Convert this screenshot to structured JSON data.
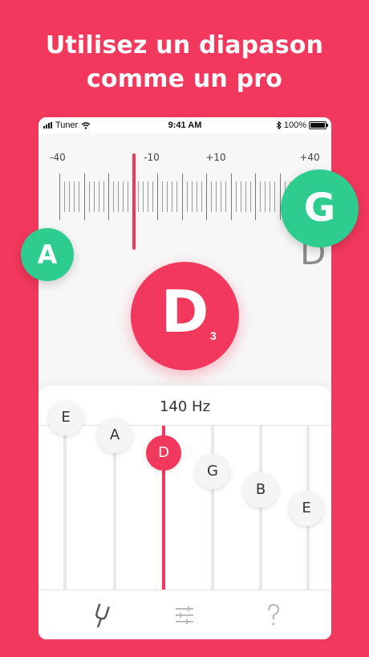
{
  "headline": {
    "line1": "Utilisez un diapason",
    "line2": "comme un pro"
  },
  "status_bar": {
    "carrier": "Tuner",
    "time": "9:41 AM",
    "battery": "100%"
  },
  "tuner": {
    "scale_labels": [
      "-40",
      "-10",
      "+10",
      "+40"
    ],
    "ghost_note": "D",
    "note": "D",
    "octave": "3",
    "frequency": "140 Hz",
    "strings": [
      "E",
      "A",
      "D",
      "G",
      "B",
      "E"
    ],
    "active_string_index": 2
  },
  "bubbles": {
    "left": "A",
    "right": "G"
  },
  "tabs": [
    {
      "name": "tuner-tab",
      "icon": "tuning-fork-icon"
    },
    {
      "name": "settings-tab",
      "icon": "sliders-icon"
    },
    {
      "name": "help-tab",
      "icon": "question-mark-icon"
    }
  ],
  "colors": {
    "accent": "#f2385c",
    "bubble": "#2ecc8f",
    "panel": "#f7f7f7"
  }
}
